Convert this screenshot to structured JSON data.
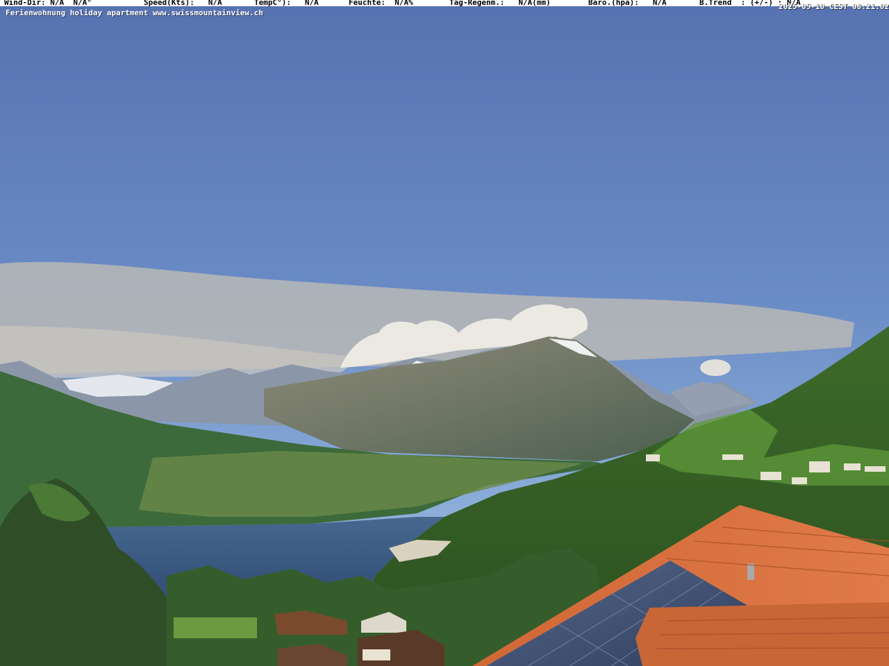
{
  "weather_bar": {
    "wind_dir": "Wind-Dir: N/A  N/A°",
    "speed": "Speed(Kts):   N/A",
    "temp": "TempC°):   N/A",
    "humidity": "Feuchte:  N/A%",
    "rain": "Tag-Regenm.:   N/A(mm)",
    "baro": "Baro.(hpa):   N/A",
    "trend": "B.Trend  : (+/-) : N/A"
  },
  "timestamp": "2025-05-10 CEST 08:21:02",
  "subtitle": "Ferienwohnung holiday apartment www.swissmountainview.ch",
  "scene": {
    "description_icon": "webcam-landscape",
    "colors": {
      "sky_top": "#5773b2",
      "sky_bottom": "#7fa3d2",
      "lake": "#3a5a80",
      "roof": "#d76f3f",
      "solar": "#3b4f74"
    }
  }
}
